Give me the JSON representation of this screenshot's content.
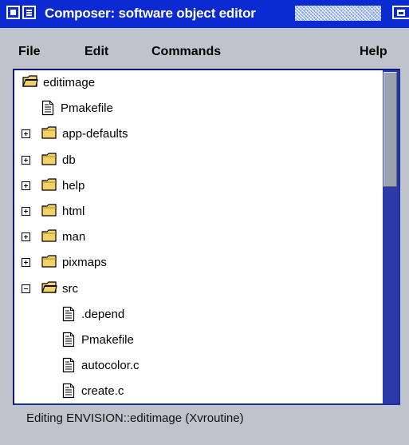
{
  "window": {
    "title": "Composer: software object editor"
  },
  "menubar": {
    "file": "File",
    "edit": "Edit",
    "commands": "Commands",
    "help": "Help"
  },
  "tree": {
    "items": [
      {
        "label": "editimage",
        "type": "folder-open",
        "expander": "none",
        "depth": 0
      },
      {
        "label": "Pmakefile",
        "type": "file",
        "expander": "none",
        "depth": 1
      },
      {
        "label": "app-defaults",
        "type": "folder",
        "expander": "plus",
        "depth": 0
      },
      {
        "label": "db",
        "type": "folder",
        "expander": "plus",
        "depth": 0
      },
      {
        "label": "help",
        "type": "folder",
        "expander": "plus",
        "depth": 0
      },
      {
        "label": "html",
        "type": "folder",
        "expander": "plus",
        "depth": 0
      },
      {
        "label": "man",
        "type": "folder",
        "expander": "plus",
        "depth": 0
      },
      {
        "label": "pixmaps",
        "type": "folder",
        "expander": "plus",
        "depth": 0
      },
      {
        "label": "src",
        "type": "folder-open",
        "expander": "minus",
        "depth": 0
      },
      {
        "label": ".depend",
        "type": "file",
        "expander": "none",
        "depth": 2
      },
      {
        "label": "Pmakefile",
        "type": "file",
        "expander": "none",
        "depth": 2
      },
      {
        "label": "autocolor.c",
        "type": "file",
        "expander": "none",
        "depth": 2
      },
      {
        "label": "create.c",
        "type": "file",
        "expander": "none",
        "depth": 2
      }
    ]
  },
  "status": {
    "text": "Editing ENVISION::editimage (Xvroutine)"
  },
  "colors": {
    "titlebar": "#0b2ad2",
    "chrome": "#bfc4cc",
    "folder": "#f2d266",
    "scrollbar_track": "#2a3aa8"
  }
}
